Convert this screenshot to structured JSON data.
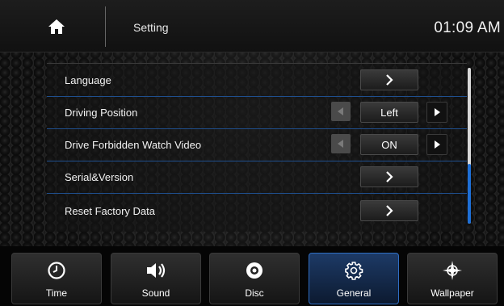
{
  "header": {
    "title": "Setting",
    "clock": "01:09 AM"
  },
  "settings": {
    "rows": [
      {
        "label": "Language",
        "control": "arrow"
      },
      {
        "label": "Driving Position",
        "control": "selector",
        "value": "Left"
      },
      {
        "label": "Drive Forbidden Watch Video",
        "control": "selector",
        "value": "ON"
      },
      {
        "label": "Serial&Version",
        "control": "arrow"
      },
      {
        "label": "Reset Factory Data",
        "control": "arrow"
      }
    ]
  },
  "scroll": {
    "position_fraction": 0.62
  },
  "tabs": [
    {
      "label": "Time",
      "icon": "clock-icon"
    },
    {
      "label": "Sound",
      "icon": "speaker-icon"
    },
    {
      "label": "Disc",
      "icon": "disc-icon"
    },
    {
      "label": "General",
      "icon": "gear-icon",
      "active": true
    },
    {
      "label": "Wallpaper",
      "icon": "wallpaper-icon"
    }
  ],
  "colors": {
    "accent": "#1e6fd6",
    "active_tab": "#1d3a66",
    "row_divider": "#1f4f8e"
  }
}
